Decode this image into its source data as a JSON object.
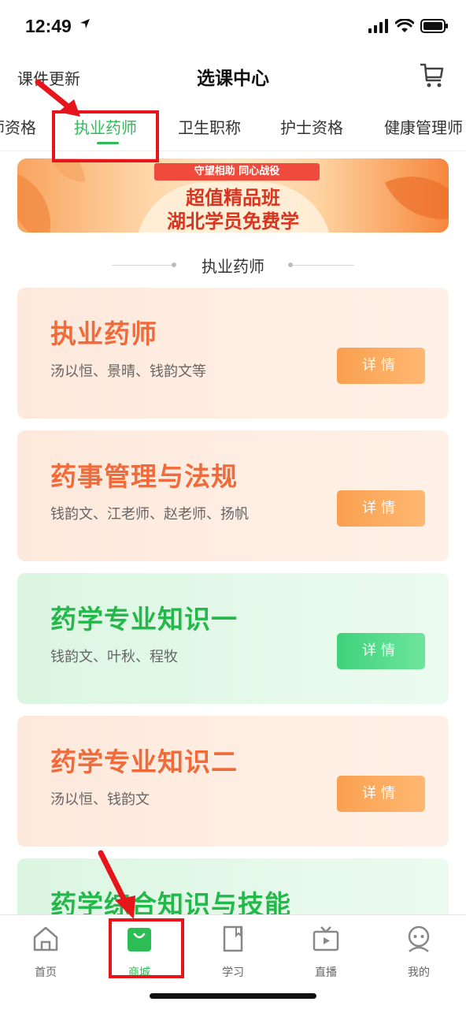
{
  "status_bar": {
    "time": "12:49"
  },
  "header": {
    "left_link": "课件更新",
    "title": "选课中心",
    "cart_icon": "cart-icon"
  },
  "tabs": [
    {
      "label": "药师资格"
    },
    {
      "label": "执业药师",
      "active": true
    },
    {
      "label": "卫生职称"
    },
    {
      "label": "护士资格"
    },
    {
      "label": "健康管理师"
    }
  ],
  "banner": {
    "ribbon": "守望相助 同心战役",
    "line1": "超值精品班",
    "line2": "湖北学员免费学"
  },
  "section": {
    "title": "执业药师"
  },
  "courses": [
    {
      "title": "执业药师",
      "teachers": "汤以恒、景晴、钱韵文等",
      "button": "详情",
      "theme": "orange"
    },
    {
      "title": "药事管理与法规",
      "teachers": "钱韵文、江老师、赵老师、扬帆",
      "button": "详情",
      "theme": "orange"
    },
    {
      "title": "药学专业知识一",
      "teachers": "钱韵文、叶秋、程牧",
      "button": "详情",
      "theme": "green"
    },
    {
      "title": "药学专业知识二",
      "teachers": "汤以恒、钱韵文",
      "button": "详情",
      "theme": "orange"
    },
    {
      "title": "药学综合知识与技能",
      "theme": "green"
    }
  ],
  "bottom_nav": [
    {
      "label": "首页",
      "icon": "home-icon"
    },
    {
      "label": "商城",
      "icon": "shop-bag-icon",
      "active": true
    },
    {
      "label": "学习",
      "icon": "book-icon"
    },
    {
      "label": "直播",
      "icon": "tv-icon"
    },
    {
      "label": "我的",
      "icon": "robot-avatar-icon"
    }
  ],
  "colors": {
    "accent_green": "#2dbd55",
    "course_orange": "#f06a3a",
    "course_green": "#22b84a",
    "annotation_red": "#e8141b"
  }
}
